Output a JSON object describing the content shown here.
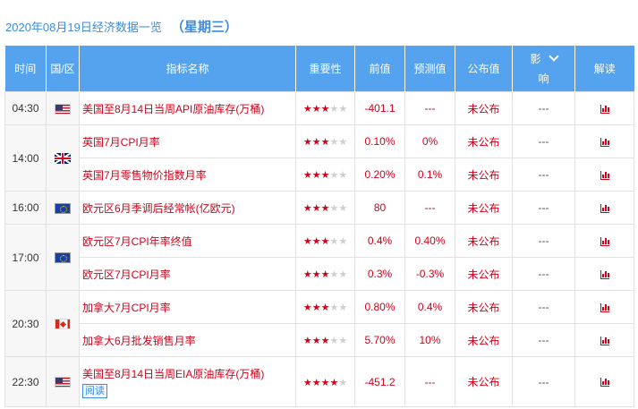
{
  "header": {
    "title": "2020年08月19日经济数据一览",
    "weekday": "（星期三）"
  },
  "columns": {
    "time": "时间",
    "region": "国/区",
    "indicator": "指标名称",
    "importance": "重要性",
    "previous": "前值",
    "forecast": "预测值",
    "actual": "公布值",
    "impact_line1": "影",
    "impact_line2": "响",
    "interpret": "解读"
  },
  "rows": [
    {
      "time": "04:30",
      "flag": "us-flag-icon",
      "indicator": "美国至8月14日当周API原油库存(万桶)",
      "stars": 3,
      "previous": "-401.1",
      "forecast": "---",
      "actual": "未公布",
      "impact": "---"
    },
    {
      "time": "14:00",
      "flag": "gb-flag-icon",
      "indicator": "英国7月CPI月率",
      "stars": 3,
      "previous": "0.10%",
      "forecast": "0%",
      "actual": "未公布",
      "impact": "---"
    },
    {
      "time": "",
      "flag": "",
      "indicator": "英国7月零售物价指数月率",
      "stars": 3,
      "previous": "0.20%",
      "forecast": "0.1%",
      "actual": "未公布",
      "impact": "---"
    },
    {
      "time": "16:00",
      "flag": "eu-flag-icon",
      "indicator": "欧元区6月季调后经常帐(亿欧元)",
      "stars": 3,
      "previous": "80",
      "forecast": "---",
      "actual": "未公布",
      "impact": "---"
    },
    {
      "time": "17:00",
      "flag": "eu-flag-icon",
      "indicator": "欧元区7月CPI年率终值",
      "stars": 3,
      "previous": "0.4%",
      "forecast": "0.40%",
      "actual": "未公布",
      "impact": "---"
    },
    {
      "time": "",
      "flag": "",
      "indicator": "欧元区7月CPI月率",
      "stars": 3,
      "previous": "0.3%",
      "forecast": "-0.3%",
      "actual": "未公布",
      "impact": "---"
    },
    {
      "time": "20:30",
      "flag": "ca-flag-icon",
      "indicator": "加拿大7月CPI月率",
      "stars": 3,
      "previous": "0.80%",
      "forecast": "0.4%",
      "actual": "未公布",
      "impact": "---"
    },
    {
      "time": "",
      "flag": "",
      "indicator": "加拿大6月批发销售月率",
      "stars": 3,
      "previous": "5.70%",
      "forecast": "10%",
      "actual": "未公布",
      "impact": "---"
    },
    {
      "time": "22:30",
      "flag": "us-flag-icon",
      "indicator": "美国至8月14日当周EIA原油库存(万桶)",
      "read_tag": "阅读",
      "stars": 4,
      "previous": "-451.2",
      "forecast": "---",
      "actual": "未公布",
      "impact": "---"
    }
  ],
  "colors": {
    "accent": "#55a3ef",
    "title": "#3d8ce0",
    "red": "#d0021b"
  }
}
